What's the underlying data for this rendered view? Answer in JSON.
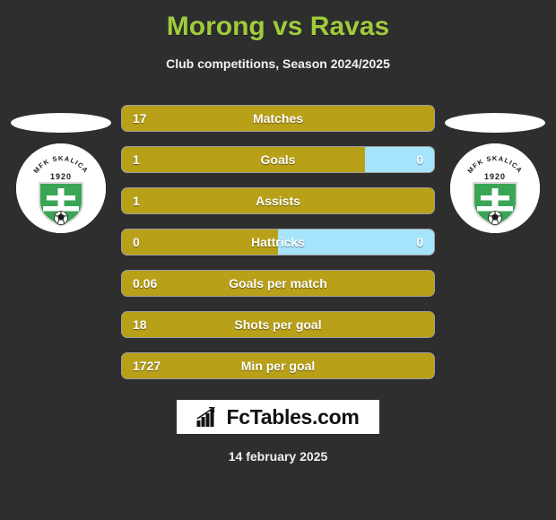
{
  "header": {
    "title": "Morong vs Ravas",
    "subtitle": "Club competitions, Season 2024/2025"
  },
  "colors": {
    "background": "#2e2e2e",
    "title": "#9fcc3b",
    "bar_home": "#b8a018",
    "bar_away": "#a5e4fb",
    "text": "#ffffff",
    "crest_green": "#3aa655"
  },
  "teams": {
    "home": {
      "crest_name": "MFK SKALICA",
      "crest_year": "1920"
    },
    "away": {
      "crest_name": "MFK SKALICA",
      "crest_year": "1920"
    }
  },
  "stats": [
    {
      "label": "Matches",
      "home": "17",
      "away": "",
      "home_pct": 100,
      "two_sided": false
    },
    {
      "label": "Goals",
      "home": "1",
      "away": "0",
      "home_pct": 78,
      "two_sided": true
    },
    {
      "label": "Assists",
      "home": "1",
      "away": "",
      "home_pct": 100,
      "two_sided": false
    },
    {
      "label": "Hattricks",
      "home": "0",
      "away": "0",
      "home_pct": 50,
      "two_sided": true
    },
    {
      "label": "Goals per match",
      "home": "0.06",
      "away": "",
      "home_pct": 100,
      "two_sided": false
    },
    {
      "label": "Shots per goal",
      "home": "18",
      "away": "",
      "home_pct": 100,
      "two_sided": false
    },
    {
      "label": "Min per goal",
      "home": "1727",
      "away": "",
      "home_pct": 100,
      "two_sided": false
    }
  ],
  "footer": {
    "logo_text": "FcTables.com",
    "logo_icon": "bar-chart-icon",
    "date": "14 february 2025"
  }
}
